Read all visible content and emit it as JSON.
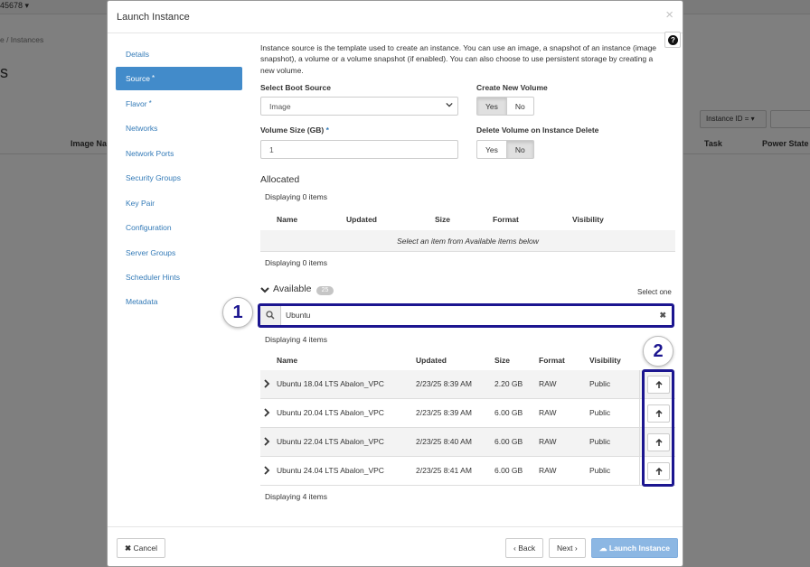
{
  "background": {
    "project_selector": "45678 ▾",
    "breadcrumb": "e /  Instances",
    "page_heading": "s",
    "filter_label": "Instance ID = ▾",
    "columns": {
      "image_name": "Image Na",
      "task": "Task",
      "power_state": "Power State"
    }
  },
  "modal": {
    "title": "Launch Instance",
    "close_glyph": "×",
    "help_glyph": "?"
  },
  "nav": {
    "items": [
      {
        "label": "Details",
        "required": false
      },
      {
        "label": "Source",
        "required": true
      },
      {
        "label": "Flavor",
        "required": true
      },
      {
        "label": "Networks",
        "required": false
      },
      {
        "label": "Network Ports",
        "required": false
      },
      {
        "label": "Security Groups",
        "required": false
      },
      {
        "label": "Key Pair",
        "required": false
      },
      {
        "label": "Configuration",
        "required": false
      },
      {
        "label": "Server Groups",
        "required": false
      },
      {
        "label": "Scheduler Hints",
        "required": false
      },
      {
        "label": "Metadata",
        "required": false
      }
    ],
    "active_index": 1,
    "required_mark": "*"
  },
  "source": {
    "help_text": "Instance source is the template used to create an instance. You can use an image, a snapshot of an instance (image snapshot), a volume or a volume snapshot (if enabled). You can also choose to use persistent storage by creating a new volume.",
    "boot_source_label": "Select Boot Source",
    "boot_source_value": "Image",
    "create_volume_label": "Create New Volume",
    "create_volume_yes": "Yes",
    "create_volume_no": "No",
    "create_volume_selected": "Yes",
    "volume_size_label": "Volume Size (GB)",
    "volume_size_value": "1",
    "delete_volume_label": "Delete Volume on Instance Delete",
    "delete_volume_yes": "Yes",
    "delete_volume_no": "No",
    "delete_volume_selected": "No"
  },
  "allocated": {
    "title": "Allocated",
    "displaying_top": "Displaying 0 items",
    "columns": [
      "Name",
      "Updated",
      "Size",
      "Format",
      "Visibility"
    ],
    "empty_message": "Select an item from Available items below",
    "displaying_bottom": "Displaying 0 items"
  },
  "available": {
    "title": "Available",
    "count": "25",
    "select_hint": "Select one",
    "search_value": "Ubuntu",
    "clear_glyph": "✖",
    "displaying_top": "Displaying 4 items",
    "columns": [
      "Name",
      "Updated",
      "Size",
      "Format",
      "Visibility"
    ],
    "rows": [
      {
        "name": "Ubuntu 18.04 LTS Abalon_VPC",
        "updated": "2/23/25 8:39 AM",
        "size": "2.20 GB",
        "format": "RAW",
        "visibility": "Public"
      },
      {
        "name": "Ubuntu 20.04 LTS Abalon_VPC",
        "updated": "2/23/25 8:39 AM",
        "size": "6.00 GB",
        "format": "RAW",
        "visibility": "Public"
      },
      {
        "name": "Ubuntu 22.04 LTS Abalon_VPC",
        "updated": "2/23/25 8:40 AM",
        "size": "6.00 GB",
        "format": "RAW",
        "visibility": "Public"
      },
      {
        "name": "Ubuntu 24.04 LTS Abalon_VPC",
        "updated": "2/23/25 8:41 AM",
        "size": "6.00 GB",
        "format": "RAW",
        "visibility": "Public"
      }
    ],
    "displaying_bottom": "Displaying 4 items"
  },
  "callouts": {
    "first": "1",
    "second": "2"
  },
  "footer": {
    "cancel": "Cancel",
    "back": "Back",
    "next": "Next",
    "launch": "Launch Instance"
  },
  "colors": {
    "accent": "#428bca",
    "link": "#337ab7",
    "highlight": "#1c1690",
    "primary_disabled": "#8cb7e3"
  }
}
